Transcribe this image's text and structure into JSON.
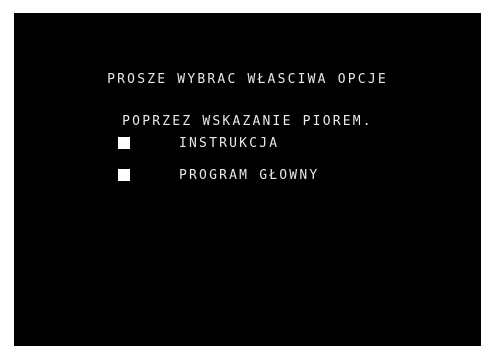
{
  "screen": {
    "background_color": "#000000",
    "text_color": "#e8e8e8",
    "prompt_line_1": "PROSZE WYBRAC WŁASCIWA OPCJE",
    "prompt_line_2": "POPRZEZ WSKAZANIE PIOREM.",
    "menu": [
      {
        "label": "INSTRUKCJA",
        "marker": "square-marker"
      },
      {
        "label": "PROGRAM GŁOWNY",
        "marker": "square-marker"
      }
    ]
  }
}
